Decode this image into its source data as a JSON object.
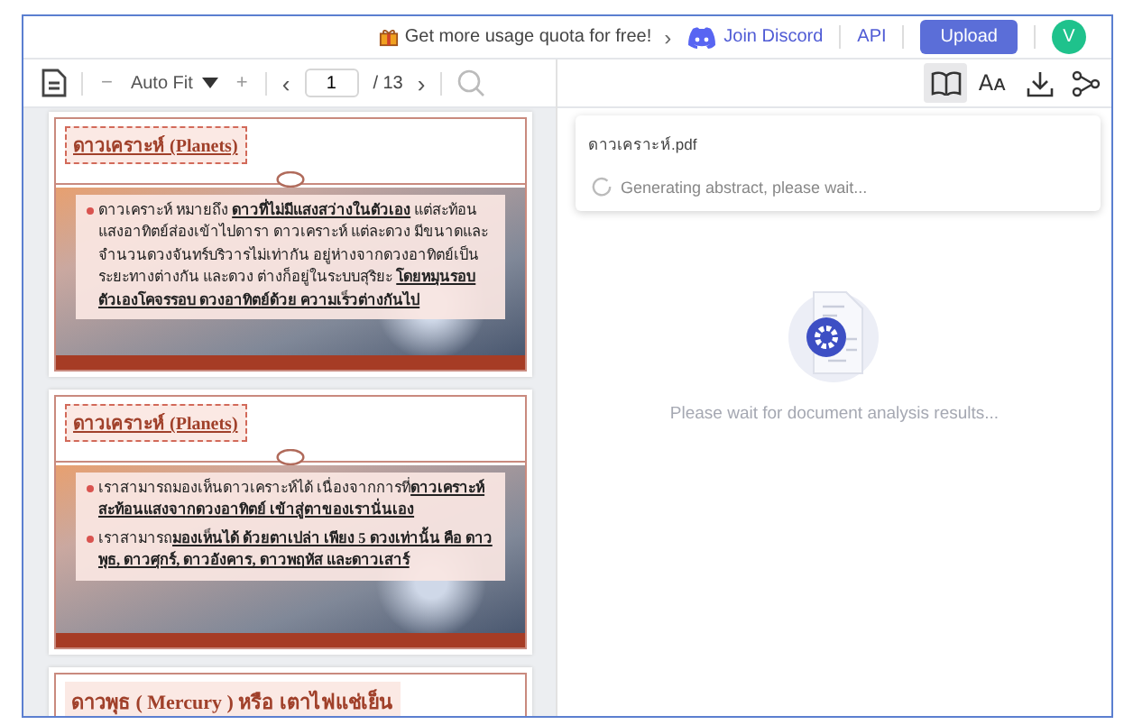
{
  "top_bar": {
    "promo": "Get more usage quota for free!",
    "promo_chevron": "›",
    "discord": "Join Discord",
    "api": "API",
    "upload": "Upload",
    "avatar": "V"
  },
  "toolbar": {
    "zoom_out": "−",
    "zoom": "Auto Fit",
    "zoom_in": "+",
    "page": "1",
    "total": "/ 13",
    "prev": "‹",
    "next": "›"
  },
  "panel_tools": [
    {
      "kind": "read",
      "selected": true
    },
    {
      "kind": "font",
      "glyph": "Aᴀ",
      "selected": false
    },
    {
      "kind": "download",
      "selected": false
    },
    {
      "kind": "share",
      "selected": false
    }
  ],
  "pages": [
    {
      "title": "ดาวเคราะห์ (Planets)",
      "bullets": [
        "ดาวเคราะห์ หมายถึง **ดาวที่ไม่มีแสงสว่างในตัวเอง** แต่สะท้อนแสงอาทิตย์ส่องเข้าไปดารา ดาวเคราะห์ แต่ละดวง มีขนาดและจำนวนดวงจันทร์บริวารไม่เท่ากัน อยู่ห่างจากดวงอาทิตย์เป็นระยะทางต่างกัน และดวง ต่างก็อยู่ในระบบสุริยะ **โดยหมุนรอบตัวเองโคจรรอบ ดวงอาทิตย์ด้วย ความเร็วต่างกันไป**"
      ]
    },
    {
      "title": "ดาวเคราะห์ (Planets)",
      "bullets": [
        "เราสามารถมองเห็นดาวเคราะห์ได้ เนื่องจากการที่**ดาวเคราะห์สะท้อนแสงจากดวงอาทิตย์ เข้าสู่ตาของเรานั่นเอง**",
        "เราสามารถ**มองเห็นได้ ด้วยตาเปล่า เพียง 5 ดวงเท่านั้น คือ ดาวพุธ, ดาวศุกร์, ดาวอังคาร, ดาวพฤหัส และดาวเสาร์**"
      ]
    },
    {
      "title": "ดาวพุธ ( Mercury ) หรือ เตาไฟแช่เย็น"
    }
  ],
  "abstract_popup": {
    "file_name": "ดาวเคราะห์.pdf",
    "status": "Generating abstract, please wait..."
  },
  "analysis_message": "Please wait for document analysis results..."
}
